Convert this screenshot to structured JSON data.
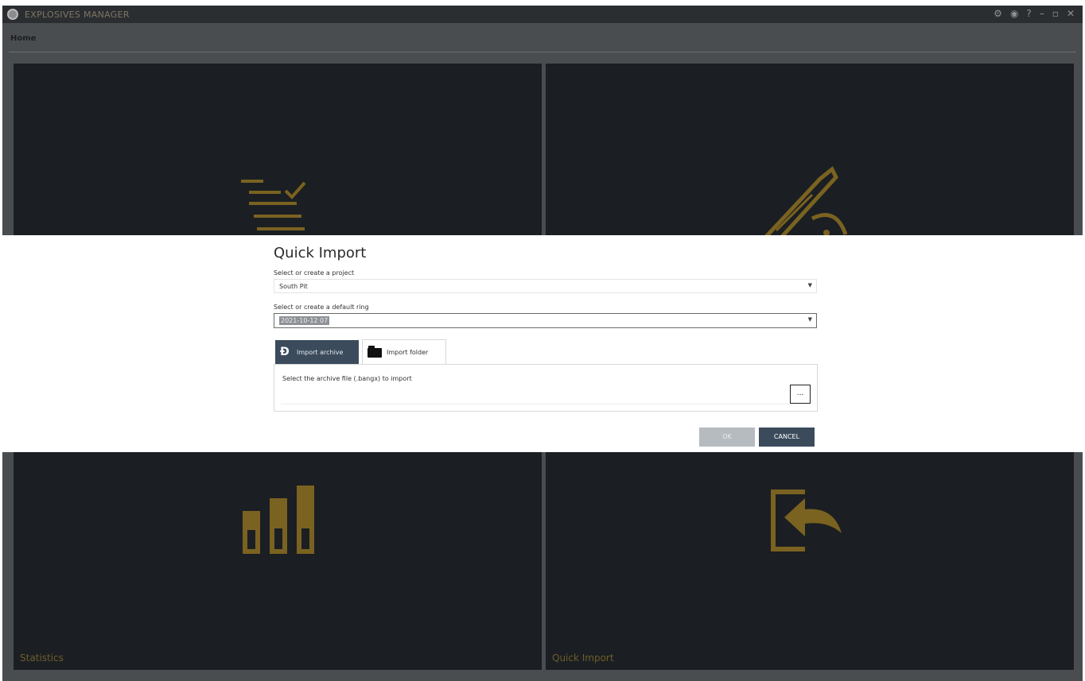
{
  "app": {
    "title": "EXPLOSIVES MANAGER",
    "menu_home": "Home",
    "window_controls": [
      "⚙",
      "◉",
      "?",
      "–",
      "▫",
      "✕"
    ]
  },
  "tiles": [
    {
      "label": "",
      "icon": "checklist-icon"
    },
    {
      "label": "",
      "icon": "drill-rig-icon"
    },
    {
      "label": "Statistics",
      "icon": "bar-chart-icon"
    },
    {
      "label": "Quick Import",
      "icon": "import-icon"
    }
  ],
  "dialog": {
    "title": "Quick Import",
    "project_label": "Select or create a project",
    "project_value": "South Pit",
    "ring_label": "Select or create a default ring",
    "ring_value": "2021-10-12 07",
    "tabs": [
      {
        "label": "Import archive",
        "icon": "archive-icon"
      },
      {
        "label": "Import folder",
        "icon": "folder-icon"
      }
    ],
    "archive_prompt": "Select the archive file (.bangx) to import",
    "browse_label": "...",
    "ok_label": "OK",
    "cancel_label": "CANCEL"
  },
  "colors": {
    "tile_bg": "#1b1f23",
    "accent_gold": "#7a6220",
    "primary_button": "#3b4b5c"
  }
}
